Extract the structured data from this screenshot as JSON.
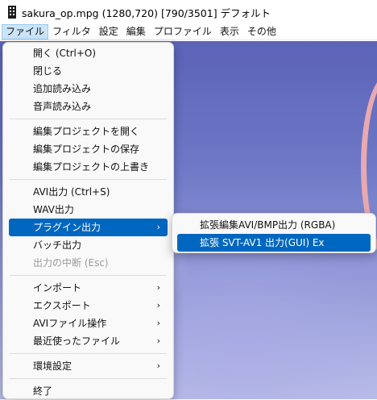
{
  "window": {
    "title": "sakura_op.mpg (1280,720)  [790/3501]  デフォルト"
  },
  "menubar": {
    "items": [
      "ファイル",
      "フィルタ",
      "設定",
      "編集",
      "プロファイル",
      "表示",
      "その他"
    ]
  },
  "file_menu": {
    "items": [
      {
        "label": "開く (Ctrl+O)"
      },
      {
        "label": "閉じる"
      },
      {
        "label": "追加読み込み"
      },
      {
        "label": "音声読み込み"
      },
      {
        "label": "編集プロジェクトを開く"
      },
      {
        "label": "編集プロジェクトの保存"
      },
      {
        "label": "編集プロジェクトの上書き"
      },
      {
        "label": "AVI出力 (Ctrl+S)"
      },
      {
        "label": "WAV出力"
      },
      {
        "label": "プラグイン出力",
        "submenu": true,
        "highlighted": true
      },
      {
        "label": "バッチ出力"
      },
      {
        "label": "出力の中断 (Esc)",
        "disabled": true
      },
      {
        "label": "インポート",
        "submenu": true
      },
      {
        "label": "エクスポート",
        "submenu": true
      },
      {
        "label": "AVIファイル操作",
        "submenu": true
      },
      {
        "label": "最近使ったファイル",
        "submenu": true
      },
      {
        "label": "環境設定",
        "submenu": true
      },
      {
        "label": "終了"
      }
    ],
    "submenu_arrow": "›"
  },
  "plugin_submenu": {
    "items": [
      {
        "label": "拡張編集AVI/BMP出力 (RGBA)"
      },
      {
        "label": "拡張 SVT-AV1 出力(GUI) Ex",
        "highlighted": true
      }
    ]
  },
  "colors": {
    "highlight": "#0067c0",
    "menu_bg": "#f9f9f9",
    "menubar_active": "#cce4f7"
  },
  "icons": {
    "app": "film-strip-icon"
  }
}
